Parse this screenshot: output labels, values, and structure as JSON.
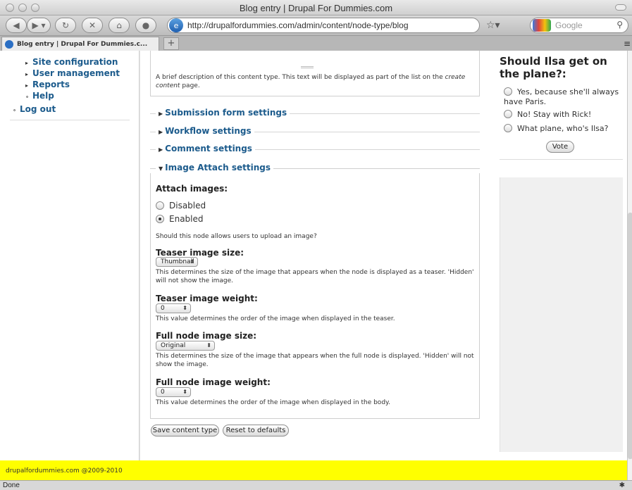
{
  "window": {
    "title": "Blog entry | Drupal For Dummies.com"
  },
  "toolbar": {
    "url": "http://drupalfordummies.com/admin/content/node-type/blog",
    "search_placeholder": "Google"
  },
  "tabs": [
    {
      "label": "Blog entry | Drupal For Dummies.c..."
    }
  ],
  "sidebar": {
    "items": [
      {
        "label": "Site configuration",
        "bullet": "▸"
      },
      {
        "label": "User management",
        "bullet": "▸"
      },
      {
        "label": "Reports",
        "bullet": "▸"
      },
      {
        "label": "Help",
        "bullet": "∘"
      },
      {
        "label": "Log out",
        "bullet": "∘"
      }
    ]
  },
  "main": {
    "description_text": "A brief description of this content type. This text will be displayed as part of the list on the",
    "description_em": "create content",
    "description_tail": "page.",
    "collapsed_sections": [
      "Submission form settings",
      "Workflow settings",
      "Comment settings"
    ],
    "image_attach": {
      "legend": "Image Attach settings",
      "attach_label": "Attach images:",
      "options": [
        {
          "label": "Disabled",
          "selected": false
        },
        {
          "label": "Enabled",
          "selected": true
        }
      ],
      "attach_help": "Should this node allows users to upload an image?",
      "teaser_size_label": "Teaser image size:",
      "teaser_size_value": "Thumbnail",
      "teaser_size_help": "This determines the size of the image that appears when the node is displayed as a teaser. 'Hidden' will not show the image.",
      "teaser_weight_label": "Teaser image weight:",
      "teaser_weight_value": "0",
      "teaser_weight_help": "This value determines the order of the image when displayed in the teaser.",
      "full_size_label": "Full node image size:",
      "full_size_value": "Original",
      "full_size_help": "This determines the size of the image that appears when the full node is displayed. 'Hidden' will not show the image.",
      "full_weight_label": "Full node image weight:",
      "full_weight_value": "0",
      "full_weight_help": "This value determines the order of the image when displayed in the body."
    },
    "buttons": {
      "save": "Save content type",
      "reset": "Reset to defaults"
    }
  },
  "poll": {
    "title": "Should Ilsa get on the plane?:",
    "options": [
      "Yes, because she'll always have Paris.",
      "No! Stay with Rick!",
      "What plane, who's Ilsa?"
    ],
    "vote_label": "Vote"
  },
  "footer": {
    "text": "drupalfordummies.com @2009-2010"
  },
  "status": {
    "text": "Done"
  }
}
